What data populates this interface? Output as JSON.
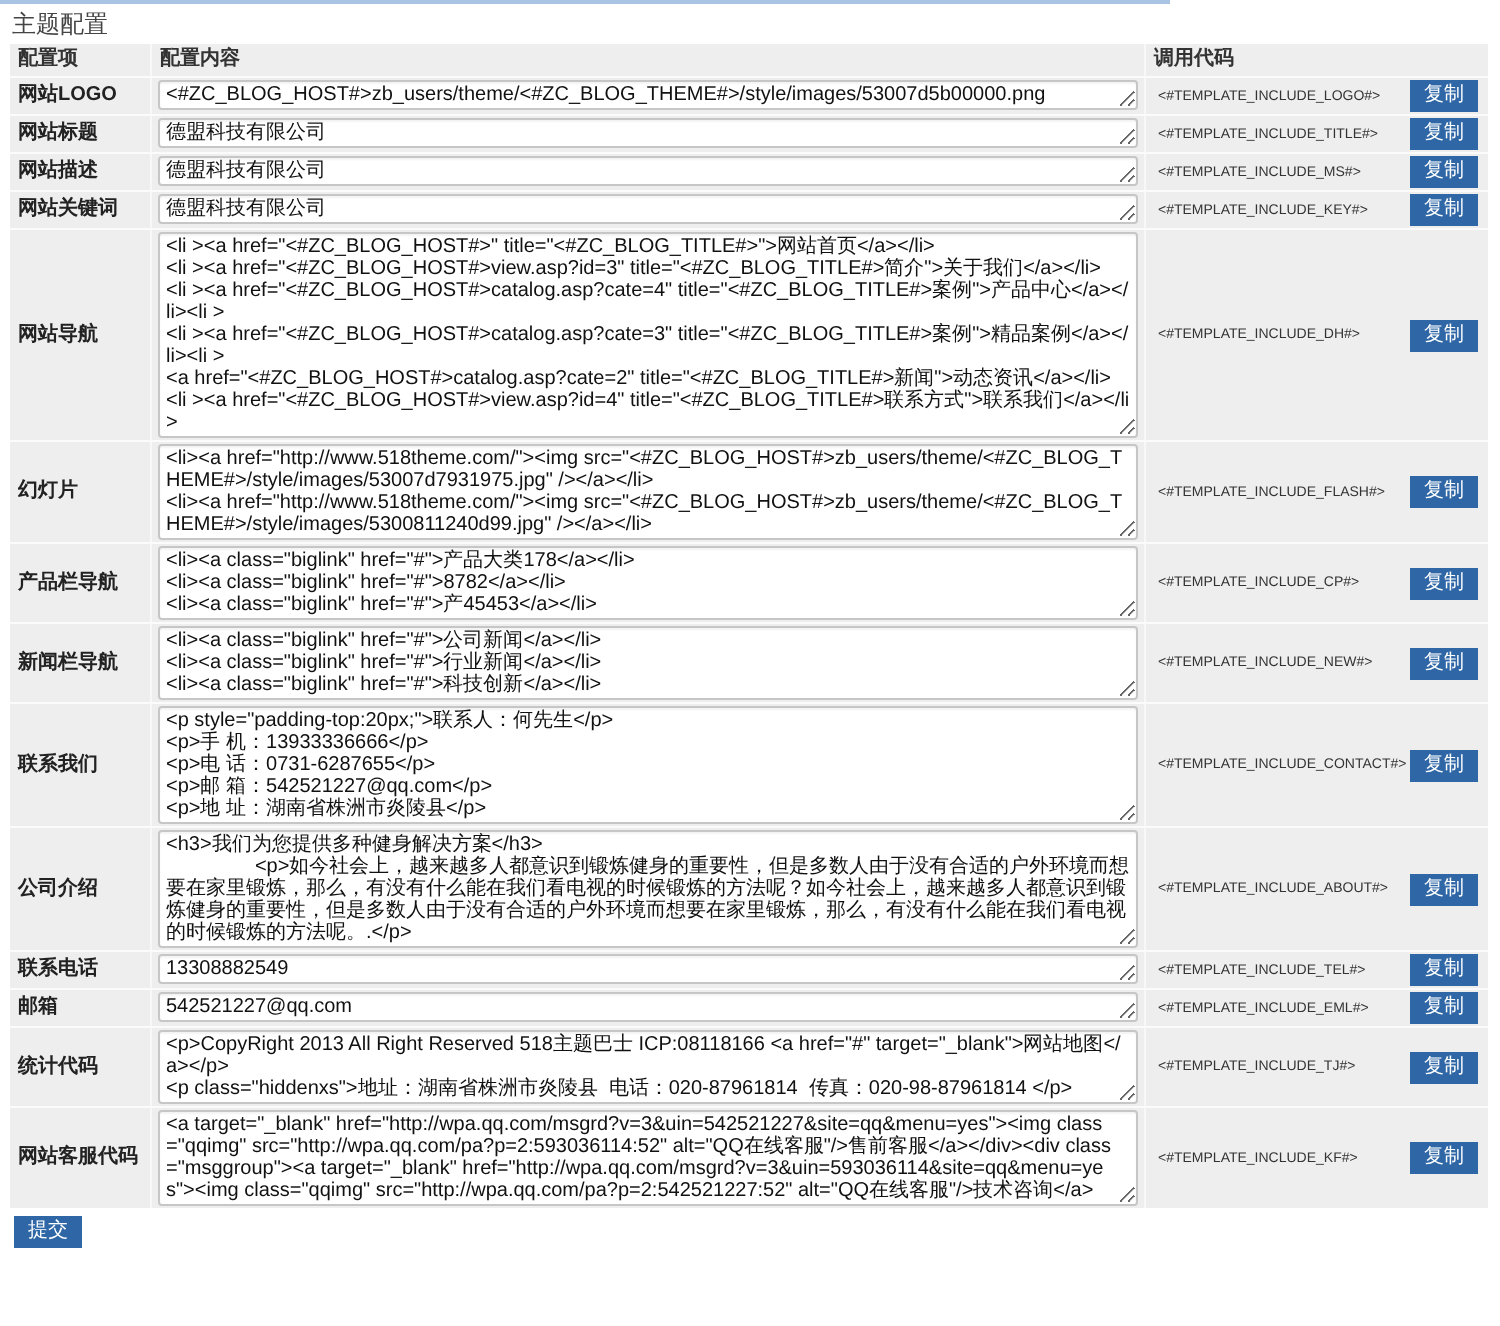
{
  "page": {
    "title": "主题配置"
  },
  "table": {
    "columns": [
      "配置项",
      "配置内容",
      "调用代码"
    ],
    "rows": [
      {
        "label": "网站LOGO",
        "content": "<#ZC_BLOG_HOST#>zb_users/theme/<#ZC_BLOG_THEME#>/style/images/53007d5b00000.png",
        "code": "<#TEMPLATE_INCLUDE_LOGO#>",
        "button": "复制"
      },
      {
        "label": "网站标题",
        "content": "德盟科技有限公司",
        "code": "<#TEMPLATE_INCLUDE_TITLE#>",
        "button": "复制"
      },
      {
        "label": "网站描述",
        "content": "德盟科技有限公司",
        "code": "<#TEMPLATE_INCLUDE_MS#>",
        "button": "复制"
      },
      {
        "label": "网站关键词",
        "content": "德盟科技有限公司",
        "code": "<#TEMPLATE_INCLUDE_KEY#>",
        "button": "复制"
      },
      {
        "label": "网站导航",
        "content": "<li ><a href=\"<#ZC_BLOG_HOST#>\" title=\"<#ZC_BLOG_TITLE#>\">网站首页</a></li>\n<li ><a href=\"<#ZC_BLOG_HOST#>view.asp?id=3\" title=\"<#ZC_BLOG_TITLE#>简介\">关于我们</a></li>\n<li ><a href=\"<#ZC_BLOG_HOST#>catalog.asp?cate=4\" title=\"<#ZC_BLOG_TITLE#>案例\">产品中心</a></li><li >\n<li ><a href=\"<#ZC_BLOG_HOST#>catalog.asp?cate=3\" title=\"<#ZC_BLOG_TITLE#>案例\">精品案例</a></li><li >\n<a href=\"<#ZC_BLOG_HOST#>catalog.asp?cate=2\" title=\"<#ZC_BLOG_TITLE#>新闻\">动态资讯</a></li>\n<li ><a href=\"<#ZC_BLOG_HOST#>view.asp?id=4\" title=\"<#ZC_BLOG_TITLE#>联系方式\">联系我们</a></li>",
        "code": "<#TEMPLATE_INCLUDE_DH#>",
        "button": "复制"
      },
      {
        "label": "幻灯片",
        "content": "<li><a href=\"http://www.518theme.com/\"><img src=\"<#ZC_BLOG_HOST#>zb_users/theme/<#ZC_BLOG_THEME#>/style/images/53007d7931975.jpg\" /></a></li>\n<li><a href=\"http://www.518theme.com/\"><img src=\"<#ZC_BLOG_HOST#>zb_users/theme/<#ZC_BLOG_THEME#>/style/images/5300811240d99.jpg\" /></a></li>",
        "code": "<#TEMPLATE_INCLUDE_FLASH#>",
        "button": "复制"
      },
      {
        "label": "产品栏导航",
        "content": "<li><a class=\"biglink\" href=\"#\">产品大类178</a></li>\n<li><a class=\"biglink\" href=\"#\">8782</a></li>\n<li><a class=\"biglink\" href=\"#\">产45453</a></li>",
        "code": "<#TEMPLATE_INCLUDE_CP#>",
        "button": "复制"
      },
      {
        "label": "新闻栏导航",
        "content": "<li><a class=\"biglink\" href=\"#\">公司新闻</a></li>\n<li><a class=\"biglink\" href=\"#\">行业新闻</a></li>\n<li><a class=\"biglink\" href=\"#\">科技创新</a></li>",
        "code": "<#TEMPLATE_INCLUDE_NEW#>",
        "button": "复制"
      },
      {
        "label": "联系我们",
        "content": "<p style=\"padding-top:20px;\">联系人：何先生</p>\n<p>手 机：13933336666</p>\n<p>电 话：0731-6287655</p>\n<p>邮 箱：542521227@qq.com</p>\n<p>地 址：湖南省株洲市炎陵县</p>",
        "code": "<#TEMPLATE_INCLUDE_CONTACT#>",
        "button": "复制"
      },
      {
        "label": "公司介绍",
        "content": "<h3>我们为您提供多种健身解决方案</h3>\n\t\t<p>如今社会上，越来越多人都意识到锻炼健身的重要性，但是多数人由于没有合适的户外环境而想要在家里锻炼，那么，有没有什么能在我们看电视的时候锻炼的方法呢？如今社会上，越来越多人都意识到锻炼健身的重要性，但是多数人由于没有合适的户外环境而想要在家里锻炼，那么，有没有什么能在我们看电视的时候锻炼的方法呢。.</p>",
        "code": "<#TEMPLATE_INCLUDE_ABOUT#>",
        "button": "复制"
      },
      {
        "label": "联系电话",
        "content": "13308882549",
        "code": "<#TEMPLATE_INCLUDE_TEL#>",
        "button": "复制"
      },
      {
        "label": "邮箱",
        "content": "542521227@qq.com",
        "code": "<#TEMPLATE_INCLUDE_EML#>",
        "button": "复制"
      },
      {
        "label": "统计代码",
        "content": "<p>CopyRight 2013 All Right Reserved 518主题巴士 ICP:08118166 <a href=\"#\" target=\"_blank\">网站地图</a></p>\n<p class=\"hiddenxs\">地址：湖南省株洲市炎陵县  电话：020-87961814  传真：020-98-87961814 </p>",
        "code": "<#TEMPLATE_INCLUDE_TJ#>",
        "button": "复制"
      },
      {
        "label": "网站客服代码",
        "content": "<a target=\"_blank\" href=\"http://wpa.qq.com/msgrd?v=3&uin=542521227&site=qq&menu=yes\"><img class=\"qqimg\" src=\"http://wpa.qq.com/pa?p=2:593036114:52\" alt=\"QQ在线客服\"/>售前客服</a></div><div class=\"msggroup\"><a target=\"_blank\" href=\"http://wpa.qq.com/msgrd?v=3&uin=593036114&site=qq&menu=yes\"><img class=\"qqimg\" src=\"http://wpa.qq.com/pa?p=2:542521227:52\" alt=\"QQ在线客服\"/>技术咨询</a>",
        "code": "<#TEMPLATE_INCLUDE_KF#>",
        "button": "复制"
      }
    ]
  },
  "submit_button": "提交"
}
